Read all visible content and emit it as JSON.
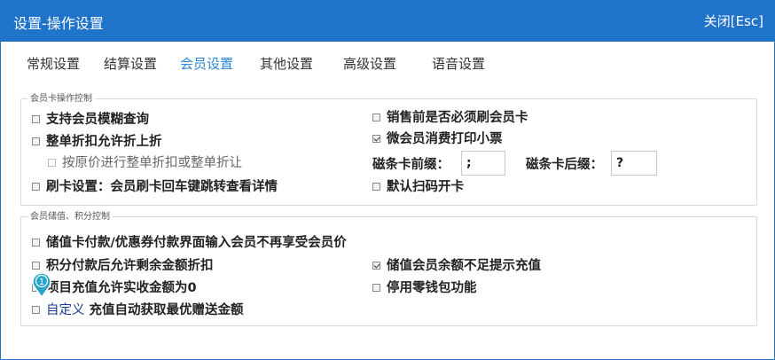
{
  "window": {
    "title": "设置-操作设置",
    "close_label": "关闭[Esc]"
  },
  "tabs": [
    {
      "label": "常规设置",
      "active": false
    },
    {
      "label": "结算设置",
      "active": false
    },
    {
      "label": "会员设置",
      "active": true
    },
    {
      "label": "其他设置",
      "active": false
    },
    {
      "label": "高级设置",
      "active": false
    },
    {
      "label": "语音设置",
      "active": false
    }
  ],
  "group1": {
    "title": "会员卡操作控制",
    "left": [
      {
        "label": "支持会员模糊查询",
        "checked": false
      },
      {
        "label": "整单折扣允许折上折",
        "checked": false
      },
      {
        "label": "按原价进行整单折扣或整单折让",
        "checked": false,
        "disabled": true
      },
      {
        "label": "刷卡设置：会员刷卡回车键跳转查看详情",
        "checked": false
      }
    ],
    "right": [
      {
        "label": "销售前是否必须刷会员卡",
        "checked": false
      },
      {
        "label": "微会员消费打印小票",
        "checked": true
      }
    ],
    "prefix_label": "磁条卡前缀：",
    "prefix_value": ";",
    "suffix_label": "磁条卡后缀：",
    "suffix_value": "?",
    "scan_label": "默认扫码开卡",
    "scan_checked": false
  },
  "group2": {
    "title": "会员储值、积分控制",
    "items": [
      {
        "label": "储值卡付款/优惠券付款界面输入会员不再享受会员价",
        "checked": false
      },
      {
        "label": "积分付款后允许剩余金额折扣",
        "checked": false
      },
      {
        "label": "项目充值允许实收金额为0",
        "checked": false
      },
      {
        "label_prefix": "自定义",
        "label_rest": " 充值自动获取最优赠送金额",
        "checked": false
      }
    ],
    "right": [
      {
        "label": "储值会员余额不足提示充值",
        "checked": true
      },
      {
        "label": "停用零钱包功能",
        "checked": false
      }
    ]
  },
  "annotation": {
    "marker": "1"
  },
  "colors": {
    "titlebar": "#1f73c9",
    "active_tab": "#2d87d7",
    "marker": "#2aa3c9"
  }
}
